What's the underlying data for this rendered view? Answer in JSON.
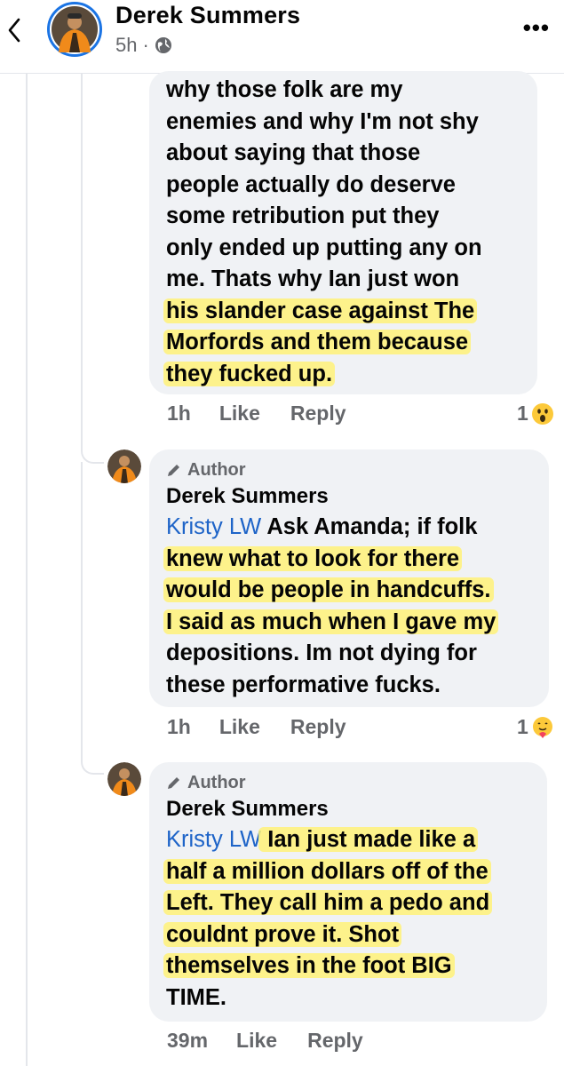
{
  "header": {
    "back_icon": "chevron-left-icon",
    "name": "Derek Summers",
    "time": "5h",
    "separator": "·",
    "privacy_icon": "globe-icon",
    "more_label": "•••"
  },
  "comments": [
    {
      "lines": [
        "why those folk are my",
        "enemies and why I'm not shy",
        "about saying that those",
        "people actually do deserve",
        "some retribution put they",
        "only ended up putting any on",
        "me. Thats why Ian just won",
        "his slander case against The",
        "Morfords and them because",
        "they fucked up."
      ],
      "time": "1h",
      "like": "Like",
      "reply": "Reply",
      "reaction_count": "1",
      "reaction_icon": "wow-reaction-icon"
    },
    {
      "author_tag": "Author",
      "author_tag_icon": "pen-icon",
      "name": "Derek Summers",
      "mention": "Kristy LW",
      "lines": [
        " Ask Amanda; if folk",
        "knew what to look for there",
        "would be people in handcuffs.",
        "I said as much when I gave my",
        "depositions. Im not dying for",
        "these performative fucks."
      ],
      "time": "1h",
      "like": "Like",
      "reply": "Reply",
      "reaction_count": "1",
      "reaction_icon": "care-reaction-icon"
    },
    {
      "author_tag": "Author",
      "author_tag_icon": "pen-icon",
      "name": "Derek Summers",
      "mention": "Kristy LW",
      "lines": [
        " Ian just made like a",
        "half a million dollars off of the",
        "Left. They call him a pedo and",
        "couldnt prove it. Shot",
        "themselves in the foot BIG",
        "TIME."
      ],
      "time": "39m",
      "like": "Like",
      "reply": "Reply"
    }
  ],
  "colors": {
    "bubble": "#f0f2f5",
    "mention": "#1e64c8",
    "highlight": "#fff278",
    "secondary_text": "#65676b"
  }
}
